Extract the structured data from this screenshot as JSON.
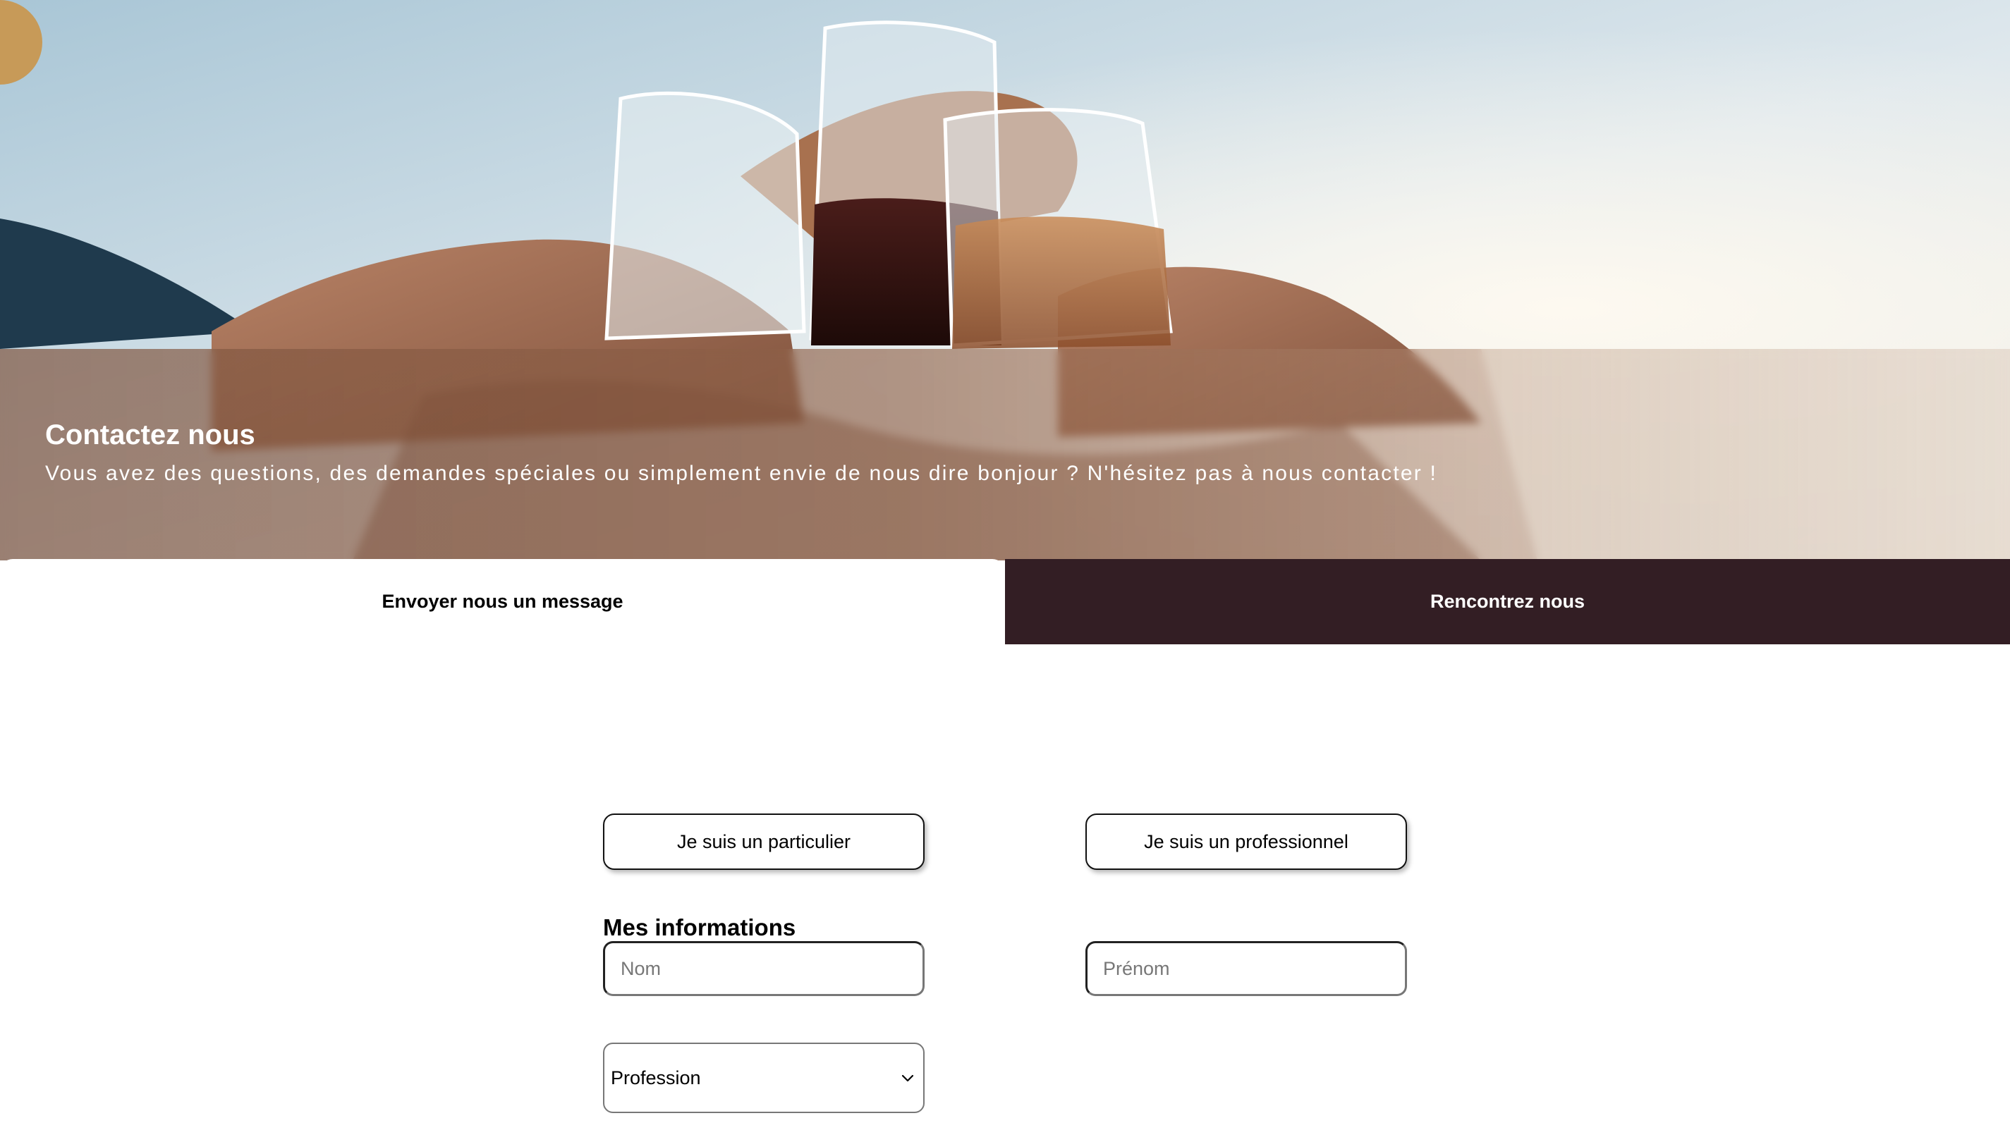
{
  "hero": {
    "title": "Contactez nous",
    "subtitle": "Vous avez des questions, des demandes spéciales ou simplement envie de nous dire bonjour ? N'hésitez pas à nous contacter !"
  },
  "tabs": [
    {
      "label": "Envoyer nous un message",
      "active": true
    },
    {
      "label": "Rencontrez nous",
      "active": false
    }
  ],
  "form": {
    "choice_particulier": "Je suis un particulier",
    "choice_professionnel": "Je suis un professionnel",
    "section_label": "Mes informations",
    "nom": {
      "placeholder": "Nom",
      "value": ""
    },
    "prenom": {
      "placeholder": "Prénom",
      "value": ""
    },
    "profession": {
      "selected": "Profession"
    }
  },
  "colors": {
    "tab_dark": "#331e24",
    "tab_light": "#ffffff"
  },
  "icons": {
    "select_arrow": "chevron-down-icon"
  }
}
